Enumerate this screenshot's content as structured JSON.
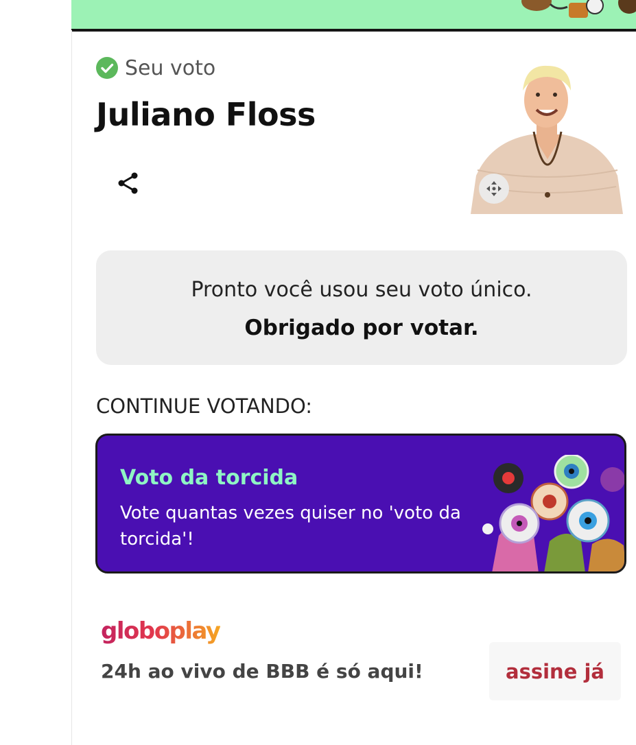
{
  "vote": {
    "status_label": "Seu voto",
    "candidate_name": "Juliano Floss"
  },
  "confirmation": {
    "line1": "Pronto você usou seu voto único.",
    "line2": "Obrigado por votar."
  },
  "continue": {
    "heading": "CONTINUE VOTANDO:",
    "card_title": "Voto da torcida",
    "card_description": "Vote quantas vezes quiser no 'voto da torcida'!"
  },
  "promo": {
    "logo": "globoplay",
    "tagline": "24h ao vivo de BBB é só aqui!",
    "button_label": "assine já"
  },
  "icons": {
    "vote_status": "check-circle-icon",
    "share": "share-icon",
    "photo_control": "move-arrows-icon"
  },
  "colors": {
    "banner": "#9cf2b5",
    "check": "#5cb85c",
    "card_background": "#4a0fb2",
    "card_title": "#8ff5c4",
    "subscribe_text": "#b22e3c"
  }
}
